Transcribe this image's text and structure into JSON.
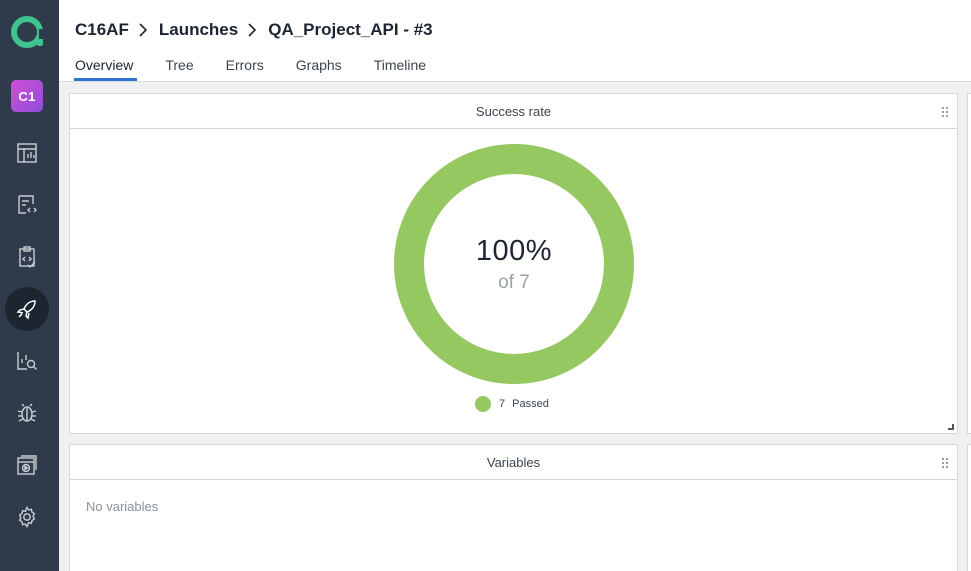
{
  "project_badge": "C1",
  "breadcrumb": {
    "project": "C16AF",
    "section": "Launches",
    "launch": "QA_Project_API - #3"
  },
  "tabs": [
    "Overview",
    "Tree",
    "Errors",
    "Graphs",
    "Timeline"
  ],
  "active_tab": "Overview",
  "success_widget": {
    "title": "Success rate",
    "percent_label": "100%",
    "of_label": "of 7",
    "passed_fraction": 1.0,
    "legend": {
      "count": "7",
      "label": "Passed",
      "color": "#95c861"
    }
  },
  "variables_widget": {
    "title": "Variables",
    "empty_text": "No variables"
  },
  "colors": {
    "sidebar": "#2f3b4a",
    "accent": "#3174d4",
    "passed": "#95c861",
    "logo": "#3ec28f"
  },
  "sidebar_icons": [
    "dashboard-icon",
    "filters-icon",
    "launches-list-icon",
    "launches-icon",
    "analytics-icon",
    "debug-icon",
    "members-icon",
    "settings-icon"
  ]
}
